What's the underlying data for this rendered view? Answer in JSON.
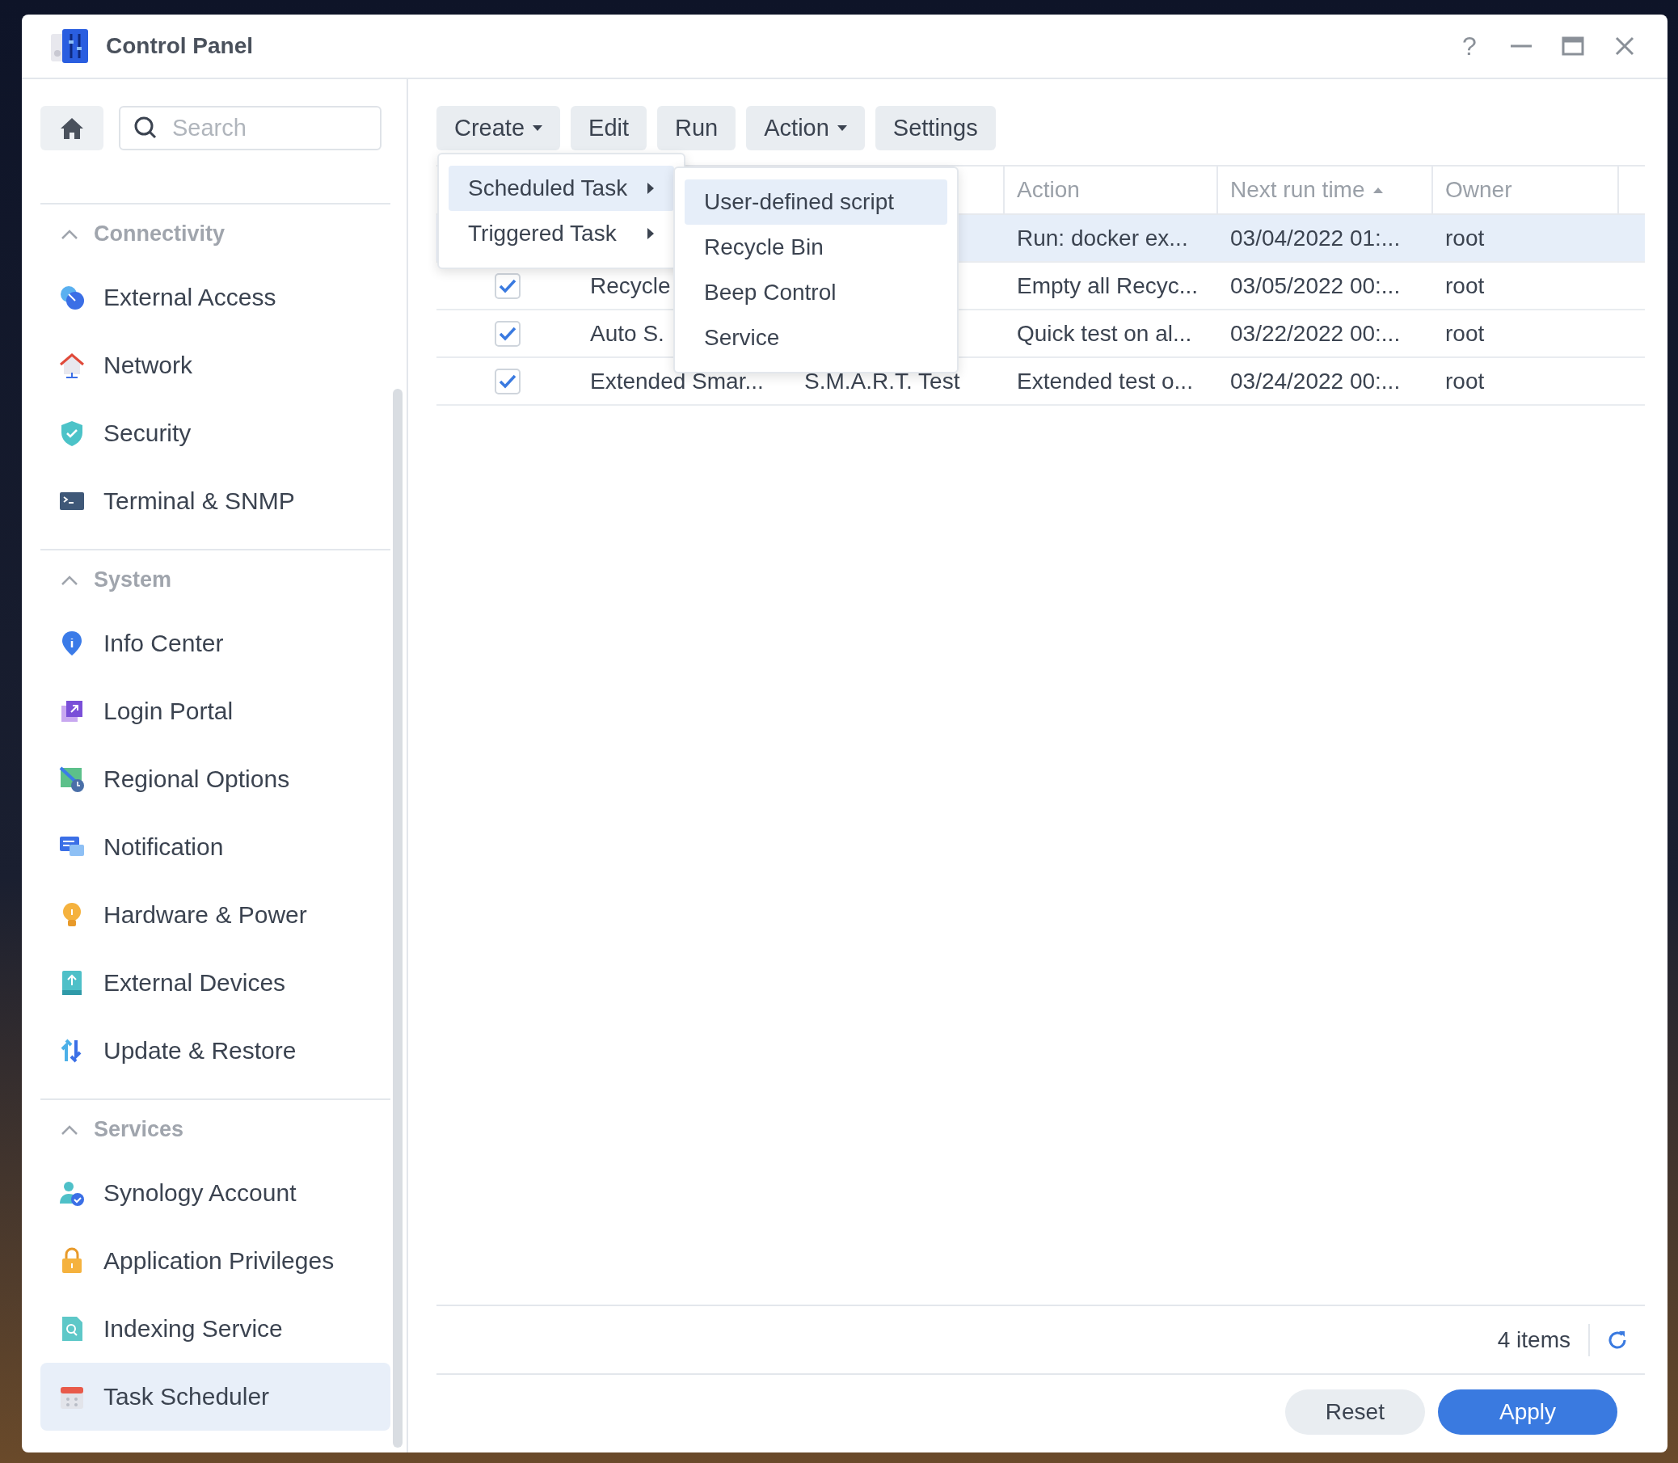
{
  "window": {
    "title": "Control Panel",
    "help": "?"
  },
  "sidebar": {
    "search": {
      "placeholder": "Search"
    },
    "groups": [
      {
        "label": "Connectivity",
        "expanded": true,
        "items": [
          {
            "label": "External Access",
            "kind": "globe",
            "selected": false
          },
          {
            "label": "Network",
            "kind": "house",
            "selected": false
          },
          {
            "label": "Security",
            "kind": "shield",
            "selected": false
          },
          {
            "label": "Terminal & SNMP",
            "kind": "terminal",
            "selected": false
          }
        ]
      },
      {
        "label": "System",
        "expanded": true,
        "items": [
          {
            "label": "Info Center",
            "kind": "info",
            "selected": false
          },
          {
            "label": "Login Portal",
            "kind": "portal",
            "selected": false
          },
          {
            "label": "Regional Options",
            "kind": "map",
            "selected": false
          },
          {
            "label": "Notification",
            "kind": "chat",
            "selected": false
          },
          {
            "label": "Hardware & Power",
            "kind": "bulb",
            "selected": false
          },
          {
            "label": "External Devices",
            "kind": "device",
            "selected": false
          },
          {
            "label": "Update & Restore",
            "kind": "update",
            "selected": false
          }
        ]
      },
      {
        "label": "Services",
        "expanded": true,
        "items": [
          {
            "label": "Synology Account",
            "kind": "account",
            "selected": false
          },
          {
            "label": "Application Privileges",
            "kind": "lock",
            "selected": false
          },
          {
            "label": "Indexing Service",
            "kind": "index",
            "selected": false
          },
          {
            "label": "Task Scheduler",
            "kind": "calendar",
            "selected": true
          }
        ]
      }
    ]
  },
  "toolbar": [
    {
      "label": "Create",
      "dropdown": true
    },
    {
      "label": "Edit",
      "dropdown": false
    },
    {
      "label": "Run",
      "dropdown": false
    },
    {
      "label": "Action",
      "dropdown": true
    },
    {
      "label": "Settings",
      "dropdown": false
    }
  ],
  "create_menu": {
    "items": [
      {
        "label": "Scheduled Task",
        "selected": true
      },
      {
        "label": "Triggered Task",
        "selected": false
      }
    ],
    "submenu": [
      {
        "label": "User-defined script",
        "selected": true
      },
      {
        "label": "Recycle Bin",
        "selected": false
      },
      {
        "label": "Beep Control",
        "selected": false
      },
      {
        "label": "Service",
        "selected": false
      }
    ]
  },
  "table": {
    "columns": [
      {
        "label": "Action",
        "sorted": false
      },
      {
        "label": "Next run time",
        "sorted": true
      },
      {
        "label": "Owner",
        "sorted": false
      }
    ],
    "rows": [
      {
        "selected": true,
        "action": "Run: docker ex...",
        "next_run": "03/04/2022 01:...",
        "owner": "root"
      },
      {
        "selected": false,
        "checked": true,
        "name": "Recycle",
        "action": "Empty all Recyc...",
        "next_run": "03/05/2022 00:...",
        "owner": "root"
      },
      {
        "selected": false,
        "checked": true,
        "name": "Auto S.",
        "action": "Quick test on al...",
        "next_run": "03/22/2022 00:...",
        "owner": "root"
      },
      {
        "selected": false,
        "checked": true,
        "name": "Extended Smar...",
        "type": "S.M.A.R.T. Test",
        "action": "Extended test o...",
        "next_run": "03/24/2022 00:...",
        "owner": "root"
      }
    ]
  },
  "status": {
    "count": "4 items"
  },
  "buttons": [
    {
      "label": "Reset",
      "primary": false
    },
    {
      "label": "Apply",
      "primary": true
    }
  ]
}
